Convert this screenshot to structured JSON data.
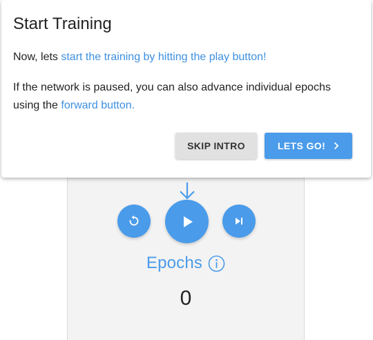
{
  "dialog": {
    "title": "Start Training",
    "p1_prefix": "Now, lets ",
    "p1_highlight": "start the training by hitting the play button!",
    "p2_line1": "If the network is paused, you can also advance individual epochs",
    "p2_prefix": "using the ",
    "p2_highlight": "forward button.",
    "skip_label": "SKIP INTRO",
    "go_label": "LETS GO!"
  },
  "controls": {
    "reset_icon": "reset-icon",
    "play_icon": "play-icon",
    "forward_icon": "step-forward-icon",
    "hint_icon": "down-arrow-icon"
  },
  "training": {
    "epochs_label": "Epochs",
    "epochs_value": "0"
  },
  "colors": {
    "accent": "#4a9bea",
    "link_text": "#3d8fdf",
    "skip_button": "#e1e1e1",
    "panel_background": "#f3f3f3"
  }
}
